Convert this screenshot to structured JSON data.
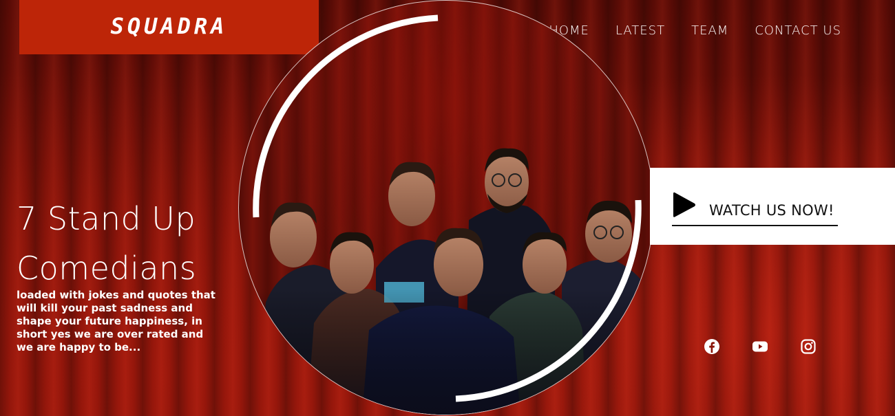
{
  "brand": {
    "name": "SQUADRA"
  },
  "nav": {
    "items": [
      {
        "label": "HOME"
      },
      {
        "label": "LATEST"
      },
      {
        "label": "TEAM"
      },
      {
        "label": "CONTACT US"
      }
    ]
  },
  "hero": {
    "headline_line1": "7 Stand Up",
    "headline_line2": "Comedians",
    "tagline": "loaded with jokes and quotes that will kill your past sadness and shape your future happiness, in short yes we are over rated and we are happy to be...",
    "photo_icon": "group-photo-of-seven-comedians"
  },
  "cta": {
    "label": "WATCH US NOW!",
    "icon": "play-icon"
  },
  "social": {
    "items": [
      {
        "icon": "facebook-icon"
      },
      {
        "icon": "youtube-icon"
      },
      {
        "icon": "instagram-icon"
      }
    ]
  },
  "colors": {
    "brand_red": "#bd2508",
    "curtain_dark": "#5e0c06",
    "curtain_light": "#a0180c",
    "cta_bg": "#ffffff",
    "cta_text": "#111111"
  }
}
